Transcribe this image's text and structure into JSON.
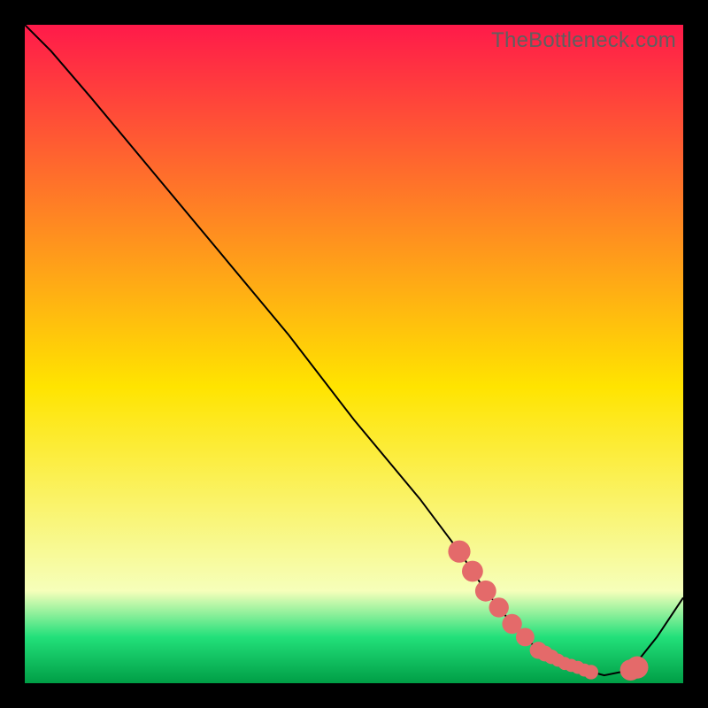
{
  "watermark": "TheBottleneck.com",
  "colors": {
    "top": "#ff1a4a",
    "mid": "#ffe400",
    "low": "#f6ffba",
    "band": "#22e07a",
    "bottom": "#009e46",
    "curve": "#000000",
    "marker": "#e46a6a",
    "frame": "#000000"
  },
  "chart_data": {
    "type": "line",
    "title": "",
    "xlabel": "",
    "ylabel": "",
    "xlim": [
      0,
      100
    ],
    "ylim": [
      0,
      100
    ],
    "x": [
      0,
      4,
      10,
      20,
      30,
      40,
      50,
      60,
      66,
      70,
      74,
      78,
      82,
      85,
      88,
      92,
      96,
      100
    ],
    "y": [
      100,
      96,
      89,
      77,
      65,
      53,
      40,
      28,
      20,
      14,
      9,
      5,
      3,
      2,
      1.2,
      2,
      7,
      13
    ],
    "series": [
      {
        "name": "bottleneck-curve",
        "x": [
          0,
          4,
          10,
          20,
          30,
          40,
          50,
          60,
          66,
          70,
          74,
          78,
          82,
          85,
          88,
          92,
          96,
          100
        ],
        "y": [
          100,
          96,
          89,
          77,
          65,
          53,
          40,
          28,
          20,
          14,
          9,
          5,
          3,
          2,
          1.2,
          2,
          7,
          13
        ]
      }
    ],
    "markers_x": [
      66,
      68,
      70,
      72,
      74,
      76,
      78,
      79,
      80,
      81,
      82,
      83,
      84,
      85,
      86,
      92,
      93
    ],
    "markers_y": [
      20,
      17,
      14,
      11.5,
      9,
      7,
      5,
      4.5,
      4,
      3.5,
      3,
      2.7,
      2.4,
      2,
      1.7,
      2,
      2.4
    ],
    "markers_r": [
      3.4,
      3.2,
      3.2,
      3.0,
      3.0,
      2.8,
      2.6,
      2.4,
      2.2,
      2.0,
      2.0,
      2.0,
      2.0,
      2.0,
      2.2,
      3.2,
      3.4
    ]
  }
}
